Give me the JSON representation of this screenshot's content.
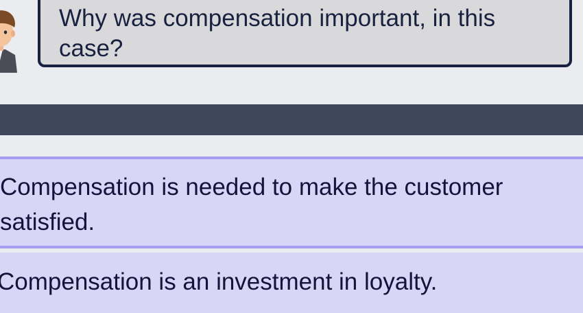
{
  "question": {
    "text": "Why was compensation important, in this case?",
    "speaker_icon": "person-avatar-icon"
  },
  "answers": [
    {
      "text": "Compensation is needed to make the customer satisfied.",
      "selected": true
    },
    {
      "text": "Compensation is an investment in loyalty.",
      "selected": false
    }
  ],
  "colors": {
    "background": "#ebecef",
    "bubble_fill": "#d9d9db",
    "bubble_border": "#18213f",
    "bar": "#3f475b",
    "option_fill": "#d8d5f6",
    "option_selected_border": "#a79df0"
  }
}
